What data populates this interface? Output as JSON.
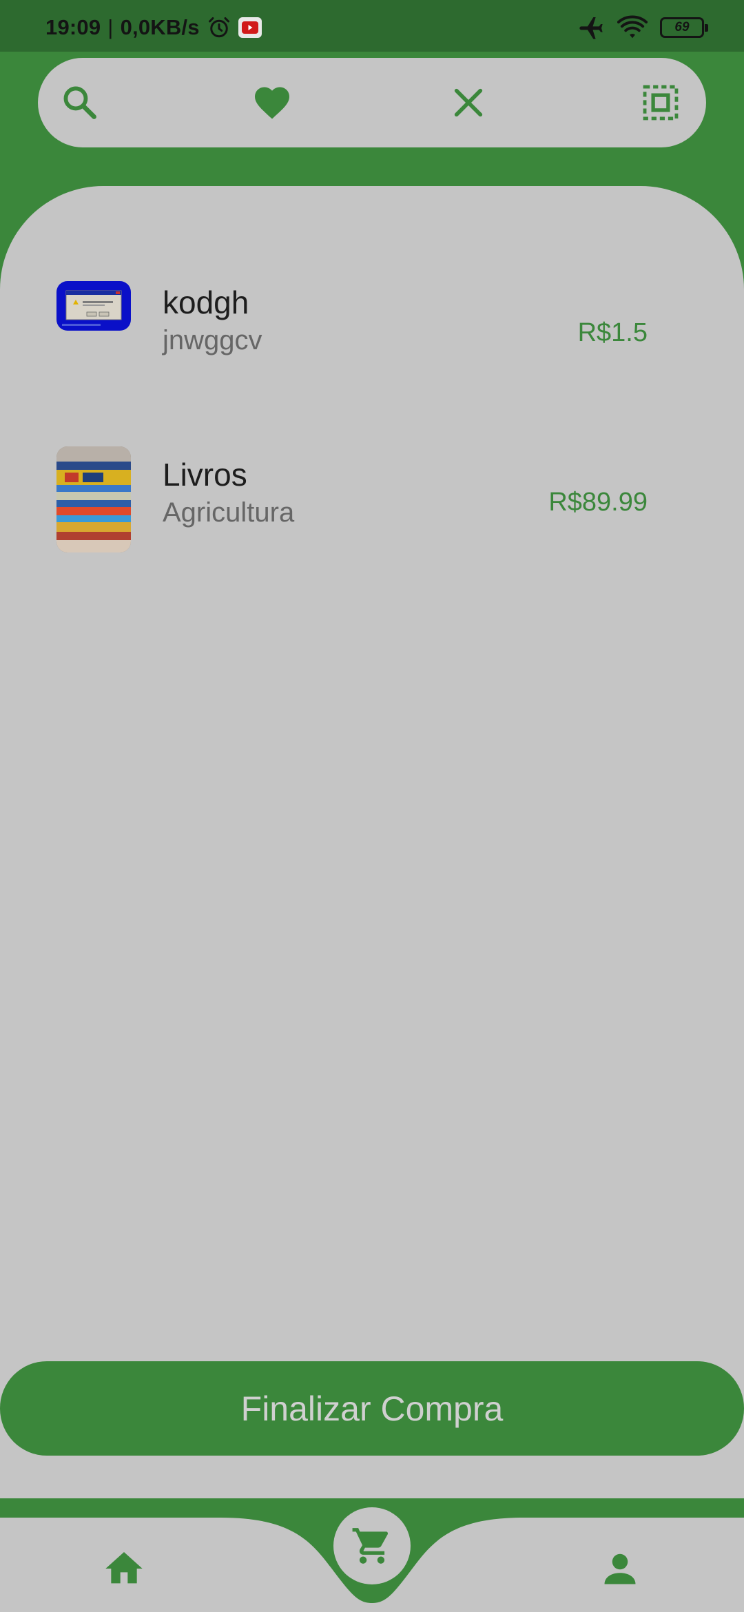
{
  "status_bar": {
    "time": "19:09",
    "separator": "|",
    "network_speed": "0,0KB/s",
    "battery": "69",
    "icons": [
      "alarm-icon",
      "youtube-icon",
      "airplane-icon",
      "wifi-icon",
      "battery-icon"
    ]
  },
  "toolbar": {
    "icons": [
      "search-icon",
      "heart-icon",
      "close-icon",
      "select-all-icon"
    ]
  },
  "cart": {
    "items": [
      {
        "name": "kodgh",
        "subtitle": "jnwggcv",
        "price": "R$1.5",
        "thumbnail": "dialog-screenshot-thumbnail"
      },
      {
        "name": "Livros",
        "subtitle": "Agricultura",
        "price": "R$89.99",
        "thumbnail": "books-photo-thumbnail"
      }
    ],
    "checkout_label": "Finalizar Compra"
  },
  "bottom_nav": {
    "items": [
      "home-icon",
      "cart-icon",
      "person-icon"
    ],
    "active": "cart-icon"
  },
  "colors": {
    "primary": "#3b873b",
    "status_bar": "#2d6a2f",
    "surface": "#c5c5c5",
    "text": "#1d1d1d",
    "text_secondary": "#666666"
  }
}
